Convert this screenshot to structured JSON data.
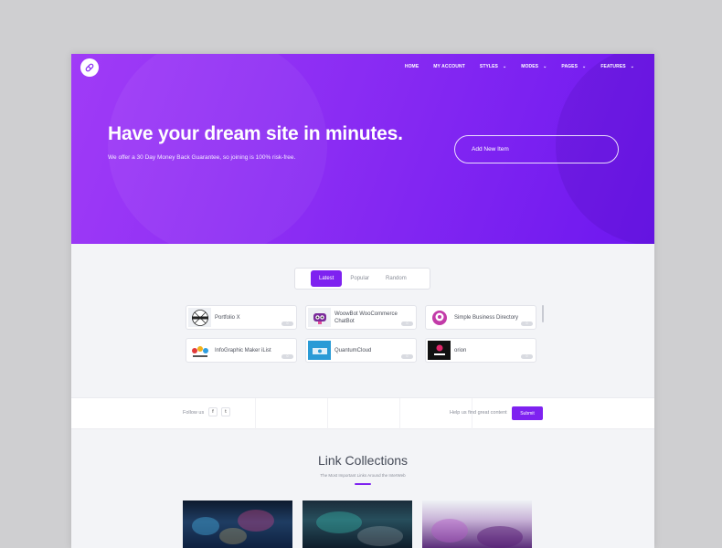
{
  "nav": {
    "items": [
      {
        "label": "HOME",
        "has_dropdown": false
      },
      {
        "label": "MY ACCOUNT",
        "has_dropdown": false
      },
      {
        "label": "STYLES",
        "has_dropdown": true
      },
      {
        "label": "MODES",
        "has_dropdown": true
      },
      {
        "label": "PAGES",
        "has_dropdown": true
      },
      {
        "label": "FEATURES",
        "has_dropdown": true
      }
    ]
  },
  "hero": {
    "title": "Have your dream site in minutes.",
    "subtitle": "We offer a 30 Day Money Back Guarantee, so joining is 100% risk-free.",
    "add_button": "Add New Item"
  },
  "tabs": [
    {
      "label": "Latest",
      "active": true
    },
    {
      "label": "Popular",
      "active": false
    },
    {
      "label": "Random",
      "active": false
    }
  ],
  "items": [
    {
      "name": "Portfolio X",
      "badge": "0"
    },
    {
      "name": "WoowBot WooCommerce ChatBot",
      "badge": "0"
    },
    {
      "name": "Simple Business Directory",
      "badge": "0"
    },
    {
      "name": "InfoGraphic Maker iList",
      "badge": "0"
    },
    {
      "name": "QuantumCloud",
      "badge": "0"
    },
    {
      "name": "orion",
      "badge": "0"
    }
  ],
  "follow": {
    "label": "Follow us",
    "facebook": "f",
    "twitter": "t",
    "help_text": "Help us find great content",
    "submit": "Submit"
  },
  "collections": {
    "title": "Link Collections",
    "subtitle": "The Most Important Links Around the InterWeb"
  },
  "colors": {
    "accent": "#7e22f0",
    "hero_start": "#a03bf7",
    "hero_end": "#6d17ef"
  }
}
